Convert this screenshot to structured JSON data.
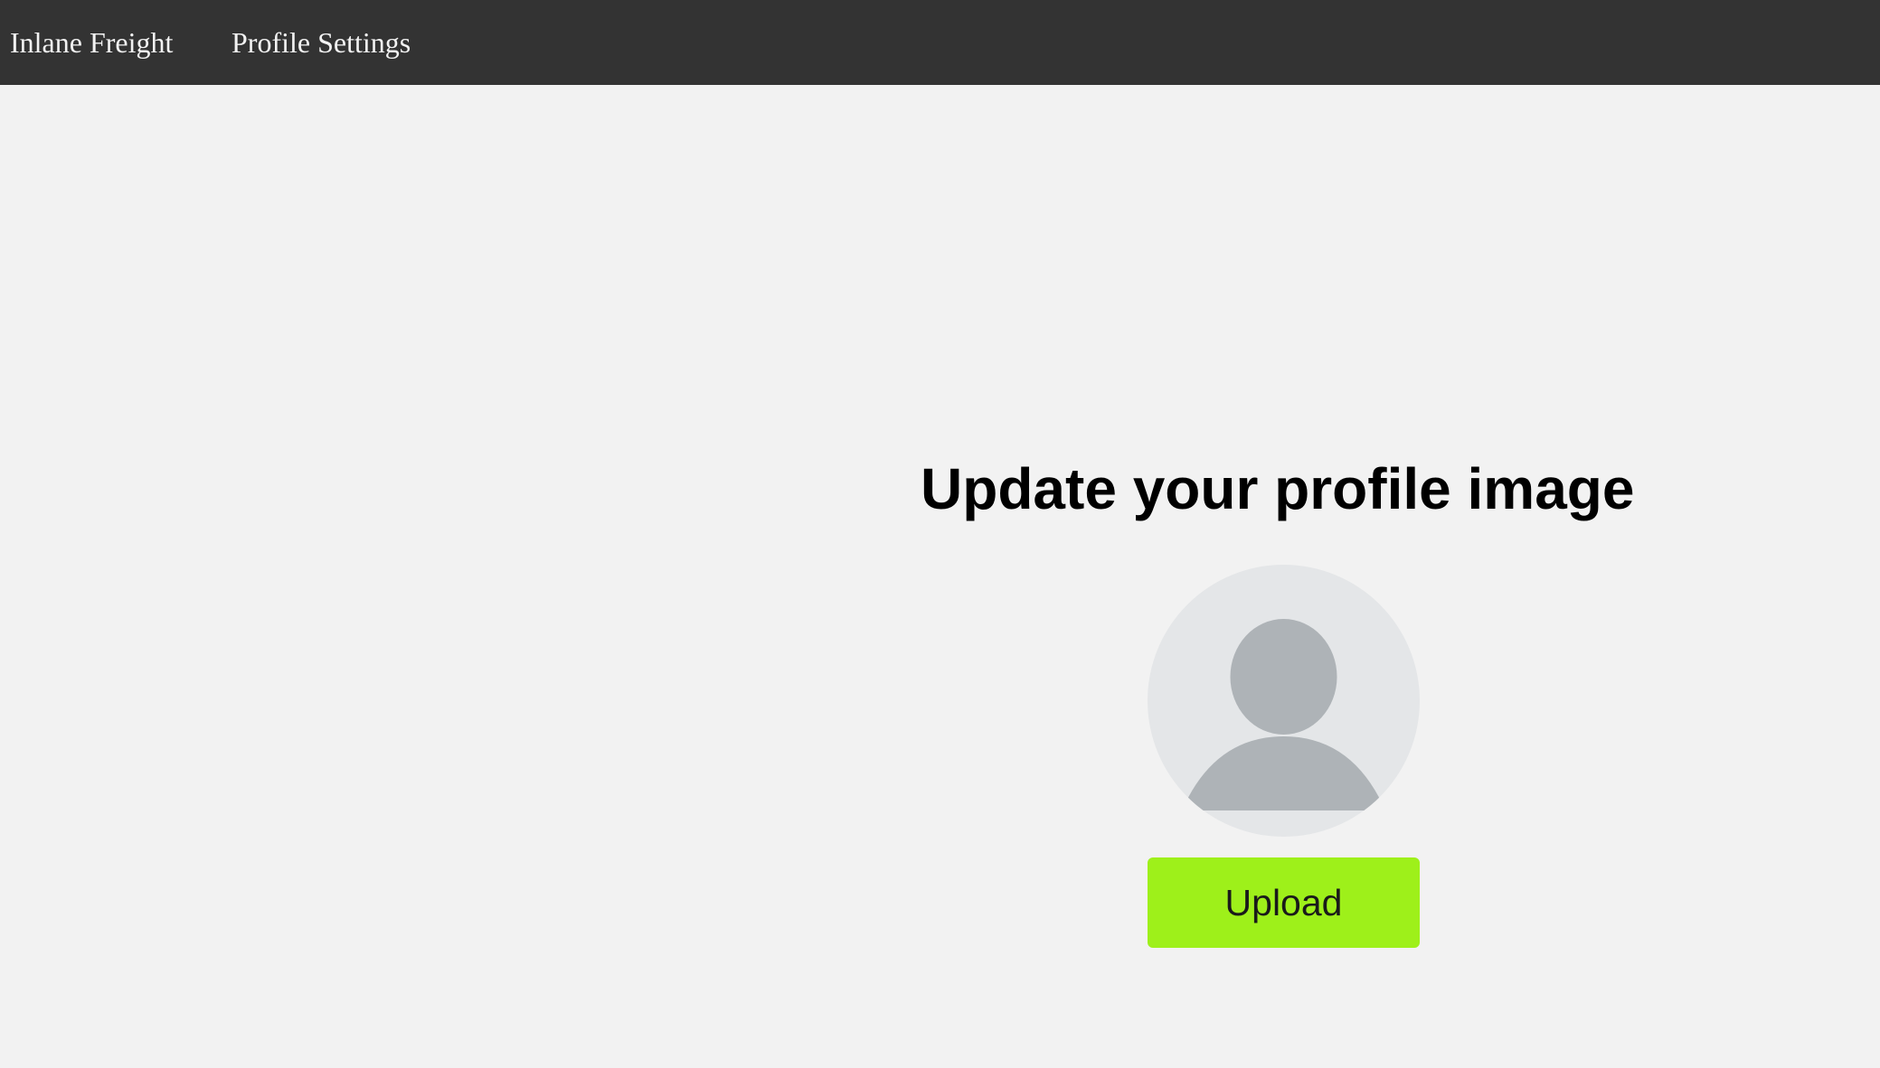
{
  "navbar": {
    "brand": "Inlane Freight",
    "links": [
      {
        "label": "Profile Settings"
      }
    ]
  },
  "main": {
    "title": "Update your profile image",
    "avatar_icon": "user-silhouette-icon",
    "upload_label": "Upload"
  },
  "colors": {
    "navbar_bg": "#333333",
    "page_bg": "#f2f2f2",
    "accent": "#9ef01a",
    "avatar_bg": "#e4e6e8",
    "avatar_figure": "#aeb3b7"
  }
}
